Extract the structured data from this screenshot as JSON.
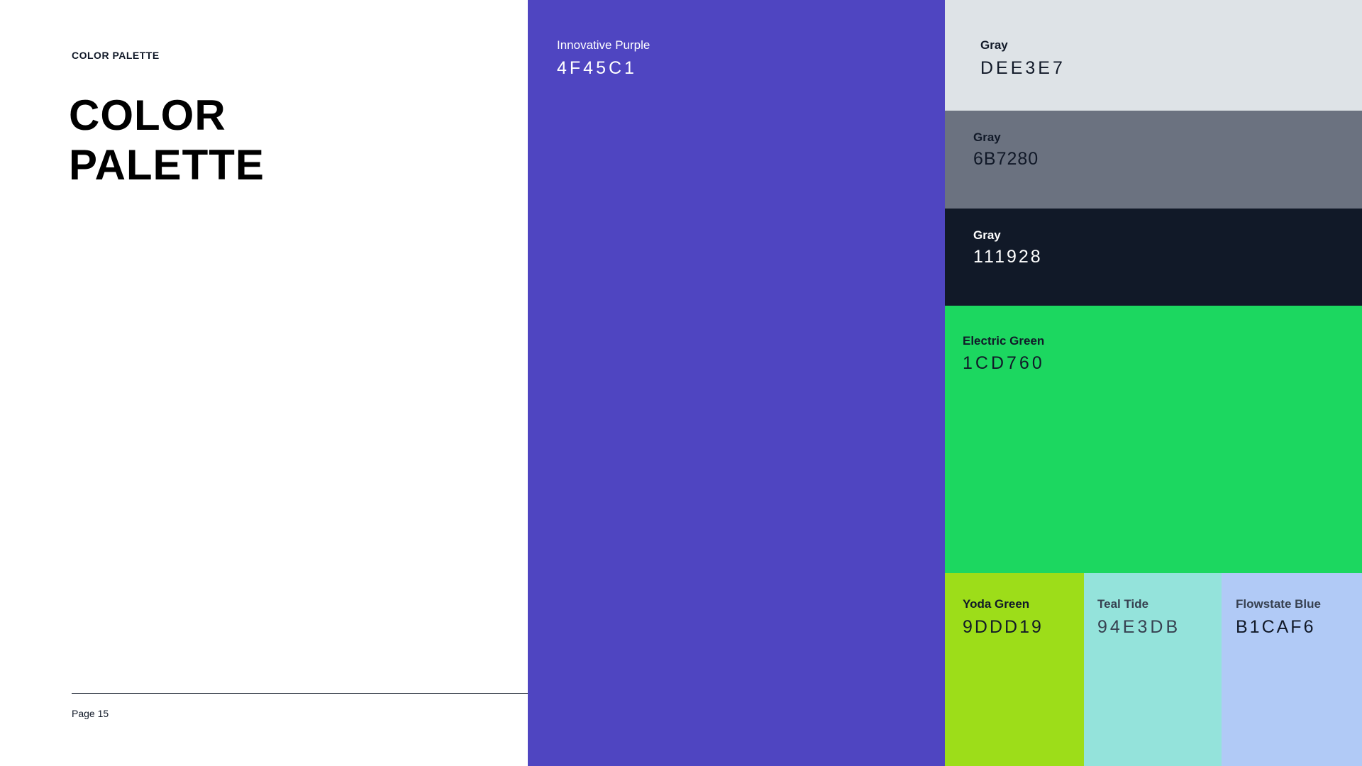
{
  "header": {
    "eyebrow": "COLOR PALETTE",
    "title_line1": "COLOR",
    "title_line2": "PALETTE"
  },
  "footer": {
    "page_label": "Page 15"
  },
  "swatches": [
    {
      "name": "Innovative Purple",
      "hex": "4F45C1",
      "color": "#4F45C1"
    },
    {
      "name": "Gray",
      "hex": "DEE3E7",
      "color": "#DEE3E7"
    },
    {
      "name": "Gray",
      "hex": "6B7280",
      "color": "#6B7280"
    },
    {
      "name": "Gray",
      "hex": "111928",
      "color": "#111928"
    },
    {
      "name": "Electric Green",
      "hex": "1CD760",
      "color": "#1CD760"
    },
    {
      "name": "Yoda Green",
      "hex": "9DDD19",
      "color": "#9DDD19"
    },
    {
      "name": "Teal Tide",
      "hex": "94E3DB",
      "color": "#94E3DB"
    },
    {
      "name": "Flowstate Blue",
      "hex": "B1CAF6",
      "color": "#B1CAF6"
    }
  ]
}
